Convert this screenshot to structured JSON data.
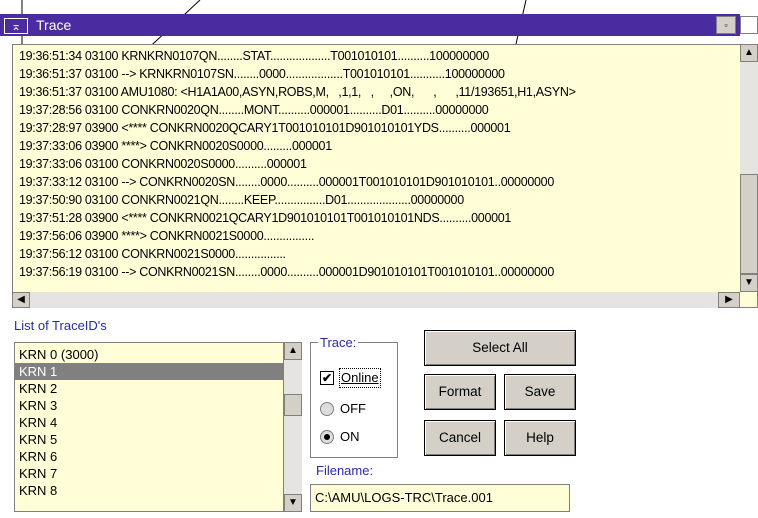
{
  "window": {
    "title": "Trace",
    "sysmenu_glyph": "⌅",
    "restore_glyph": "▫"
  },
  "log_lines": [
    "19:36:51:34 03100 KRNKRN0107QN........STAT...................T001010101..........100000000",
    "19:36:51:37 03100 --> KRNKRN0107SN........0000..................T001010101...........100000000",
    "19:36:51:37 03100 AMU1080: <H1A1A00,ASYN,ROBS,M,   ,1,1,   ,     ,ON,      ,      ,11/193651,H1,ASYN>",
    "19:37:28:56 03100 CONKRN0020QN........MONT..........000001..........D01..........00000000",
    "19:37:28:97 03900 <**** CONKRN0020QCARY1T001010101D901010101YDS..........000001",
    "19:37:33:06 03900 ****> CONKRN0020S0000.........000001",
    "19:37:33:06 03100 CONKRN0020S0000..........000001",
    "19:37:33:12 03100 --> CONKRN0020SN........0000..........000001T001010101D901010101..00000000",
    "19:37:50:90 03100 CONKRN0021QN........KEEP................D01....................00000000",
    "19:37:51:28 03900 <**** CONKRN0021QCARY1D901010101T001010101NDS..........000001",
    "19:37:56:06 03900 ****> CONKRN0021S0000................",
    "19:37:56:12 03100 CONKRN0021S0000................",
    "19:37:56:19 03100 --> CONKRN0021SN........0000..........000001D901010101T001010101..00000000"
  ],
  "list": {
    "label": "List of TraceID's",
    "items": [
      "KRN 0 (3000)",
      "KRN 1",
      "KRN 2",
      "KRN 3",
      "KRN 4",
      "KRN 5",
      "KRN 6",
      "KRN 7",
      "KRN 8"
    ],
    "selected_index": 1
  },
  "trace": {
    "group_label": "Trace:",
    "online_label": "Online",
    "online_checked": true,
    "off_label": "OFF",
    "on_label": "ON",
    "selected_radio": "ON"
  },
  "buttons": {
    "select_all": "Select All",
    "format": "Format",
    "save": "Save",
    "cancel": "Cancel",
    "help": "Help"
  },
  "filename": {
    "label": "Filename:",
    "value": "C:\\AMU\\LOGS-TRC\\Trace.001"
  },
  "colors": {
    "titlebar": "#4b2ba0",
    "log_background": "#fffed6",
    "label_text": "#2a2ab0",
    "selected_item": "#808080"
  }
}
